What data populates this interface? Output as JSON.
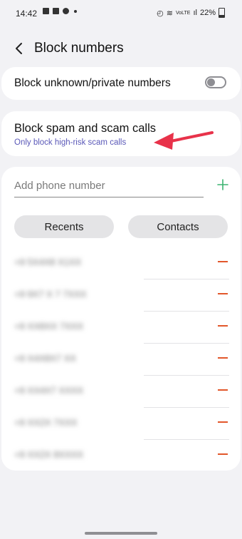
{
  "status_bar": {
    "time": "14:42",
    "battery": "22%",
    "network": "VoLTE"
  },
  "header": {
    "title": "Block numbers"
  },
  "settings": {
    "block_unknown_label": "Block unknown/private numbers",
    "block_unknown_enabled": false,
    "block_spam_label": "Block spam and scam calls",
    "block_spam_sub": "Only block high-risk scam calls"
  },
  "add_phone": {
    "placeholder": "Add phone number",
    "value": ""
  },
  "buttons": {
    "recents": "Recents",
    "contacts": "Contacts"
  },
  "blocked_numbers": [
    "+9 5X4X8 X1XX",
    "+9 9X7 X 7 7XXX",
    "+9 XX8XX 7XXX",
    "+9 X4X8X7 XX",
    "+9 XX4X7 XXXX",
    "+9 XX2X 7XXX",
    "+9 XX2X 8XXXX"
  ],
  "colors": {
    "accent_link": "#5a58b8",
    "remove": "#e2572b",
    "add": "#3cb371",
    "arrow": "#e8324a"
  }
}
